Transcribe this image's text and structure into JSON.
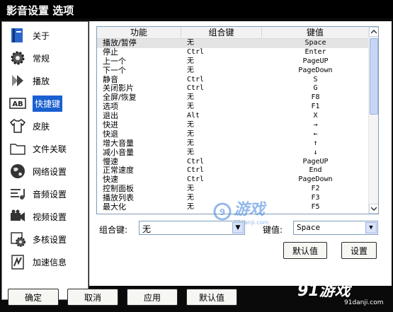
{
  "window": {
    "title": "影音设置 选项"
  },
  "sidebar": {
    "items": [
      {
        "label": "关于",
        "icon": "info-card-icon"
      },
      {
        "label": "常规",
        "icon": "gear-icon"
      },
      {
        "label": "播放",
        "icon": "play-arrow-icon"
      },
      {
        "label": "快捷键",
        "icon": "keyboard-ab-icon",
        "active": true
      },
      {
        "label": "皮肤",
        "icon": "shirt-icon"
      },
      {
        "label": "文件关联",
        "icon": "folder-icon"
      },
      {
        "label": "网络设置",
        "icon": "globe-icon"
      },
      {
        "label": "音频设置",
        "icon": "audio-lines-icon"
      },
      {
        "label": "视频设置",
        "icon": "video-camera-icon"
      },
      {
        "label": "多核设置",
        "icon": "cpu-gear-icon"
      },
      {
        "label": "加速信息",
        "icon": "accelerate-icon"
      }
    ]
  },
  "shortcut_table": {
    "headers": [
      "功能",
      "组合键",
      "键值"
    ],
    "rows": [
      [
        "播放/暂停",
        "无",
        "Space"
      ],
      [
        "停止",
        "Ctrl",
        "Enter"
      ],
      [
        "上一个",
        "无",
        "PageUP"
      ],
      [
        "下一个",
        "无",
        "PageDown"
      ],
      [
        "静音",
        "Ctrl",
        "S"
      ],
      [
        "关闭影片",
        "Ctrl",
        "G"
      ],
      [
        "全屏/恢复",
        "无",
        "F8"
      ],
      [
        "选项",
        "无",
        "F1"
      ],
      [
        "退出",
        "Alt",
        "X"
      ],
      [
        "快进",
        "无",
        "→"
      ],
      [
        "快退",
        "无",
        "←"
      ],
      [
        "增大音量",
        "无",
        "↑"
      ],
      [
        "减小音量",
        "无",
        "↓"
      ],
      [
        "慢速",
        "Ctrl",
        "PageUP"
      ],
      [
        "正常速度",
        "Ctrl",
        "End"
      ],
      [
        "快速",
        "Ctrl",
        "PageDown"
      ],
      [
        "控制面板",
        "无",
        "F2"
      ],
      [
        "播放列表",
        "无",
        "F3"
      ],
      [
        "最大化",
        "无",
        "F5"
      ]
    ]
  },
  "editor": {
    "modifier_label": "组合键:",
    "modifier_value": "无",
    "key_label": "键值:",
    "key_value": "Space",
    "default_button": "默认值",
    "set_button": "设置"
  },
  "footer": {
    "ok": "确定",
    "cancel": "取消",
    "apply": "应用",
    "defaults": "默认值"
  },
  "watermark": {
    "text": "游戏",
    "url": "91danji.com"
  },
  "corner_logo": {
    "text": "91游戏",
    "url": "91danji.com"
  },
  "colors": {
    "accent": "#1a5fd0",
    "titlebar": "#000000",
    "list_border": "#7f9db9",
    "scroll_thumb": "#c7d6f6"
  }
}
